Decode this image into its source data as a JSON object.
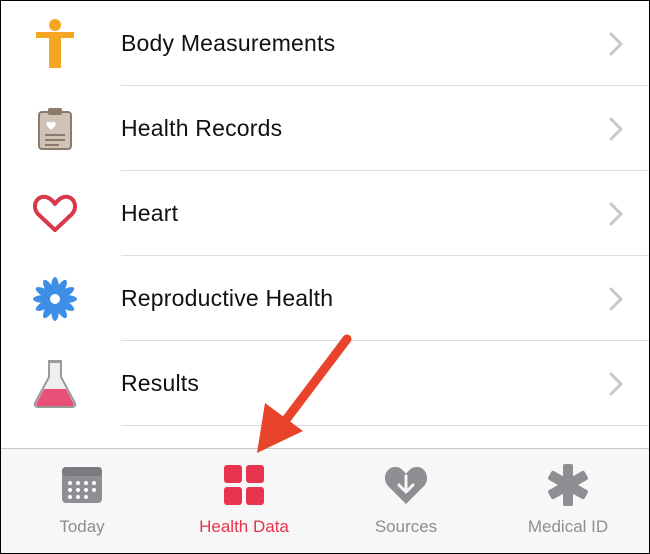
{
  "list": {
    "items": [
      {
        "label": "Body Measurements",
        "icon": "body-measurements-icon"
      },
      {
        "label": "Health Records",
        "icon": "health-records-icon"
      },
      {
        "label": "Heart",
        "icon": "heart-icon"
      },
      {
        "label": "Reproductive Health",
        "icon": "reproductive-health-icon"
      },
      {
        "label": "Results",
        "icon": "results-flask-icon"
      }
    ]
  },
  "tabbar": {
    "tabs": [
      {
        "label": "Today",
        "icon": "today-calendar-icon",
        "active": false
      },
      {
        "label": "Health Data",
        "icon": "health-data-grid-icon",
        "active": true
      },
      {
        "label": "Sources",
        "icon": "sources-heart-download-icon",
        "active": false
      },
      {
        "label": "Medical ID",
        "icon": "medical-id-asterisk-icon",
        "active": false
      }
    ]
  },
  "colors": {
    "accent": "#e8344e",
    "tab_inactive": "#8e8e93",
    "annotation_arrow": "#e8442c",
    "body_icon": "#f5a623",
    "heart_icon": "#d9384a",
    "reproductive_icon": "#3c8ee6"
  }
}
